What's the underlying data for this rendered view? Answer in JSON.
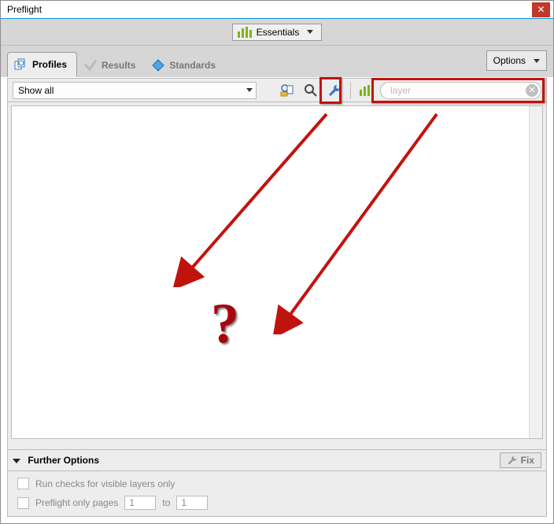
{
  "window": {
    "title": "Preflight"
  },
  "workspace": {
    "label": "Essentials"
  },
  "tabs": {
    "profiles": "Profiles",
    "results": "Results",
    "standards": "Standards"
  },
  "buttons": {
    "options": "Options",
    "fix": "Fix",
    "close_glyph": "✕"
  },
  "toolbar": {
    "show_all": "Show all",
    "search_value": "layer"
  },
  "footer": {
    "heading": "Further Options",
    "run_checks": "Run checks for visible layers only",
    "preflight_pages": "Preflight only pages",
    "to": "to",
    "page_from": "1",
    "page_to": "1"
  },
  "annotation": {
    "center_mark": "?"
  }
}
